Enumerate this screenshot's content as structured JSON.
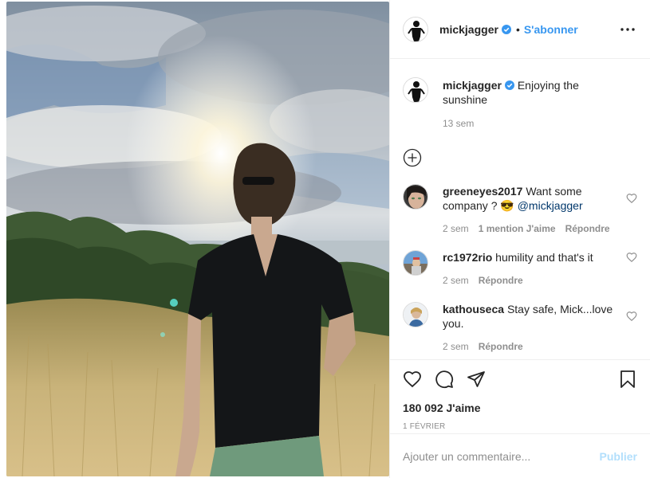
{
  "post": {
    "author": "mickjagger",
    "follow_label": "S'abonner",
    "separator": "•",
    "caption": "Enjoying the sunshine",
    "caption_age": "13 sem"
  },
  "comments": [
    {
      "user": "greeneyes2017",
      "text": "Want some company ? 😎 ",
      "mention": "@mickjagger",
      "age": "2 sem",
      "likes": "1 mention J'aime",
      "reply": "Répondre"
    },
    {
      "user": "rc1972rio",
      "text": "humility and that's it",
      "age": "2 sem",
      "reply": "Répondre"
    },
    {
      "user": "kathouseca",
      "text": "Stay safe, Mick...love you.",
      "age": "2 sem",
      "reply": "Répondre"
    }
  ],
  "stats": {
    "likes": "180 092 J'aime",
    "date": "1 FÉVRIER"
  },
  "composer": {
    "placeholder": "Ajouter un commentaire...",
    "publish": "Publier"
  },
  "icons": {
    "like": "heart-icon",
    "comment": "comment-icon",
    "share": "paper-plane-icon",
    "save": "bookmark-icon",
    "more": "more-options-icon",
    "load_more": "plus-circle-icon",
    "verified": "verified-badge-icon"
  },
  "colors": {
    "link": "#3897f0",
    "publish_disabled": "#b2dffc",
    "muted": "#8e8e8e"
  }
}
